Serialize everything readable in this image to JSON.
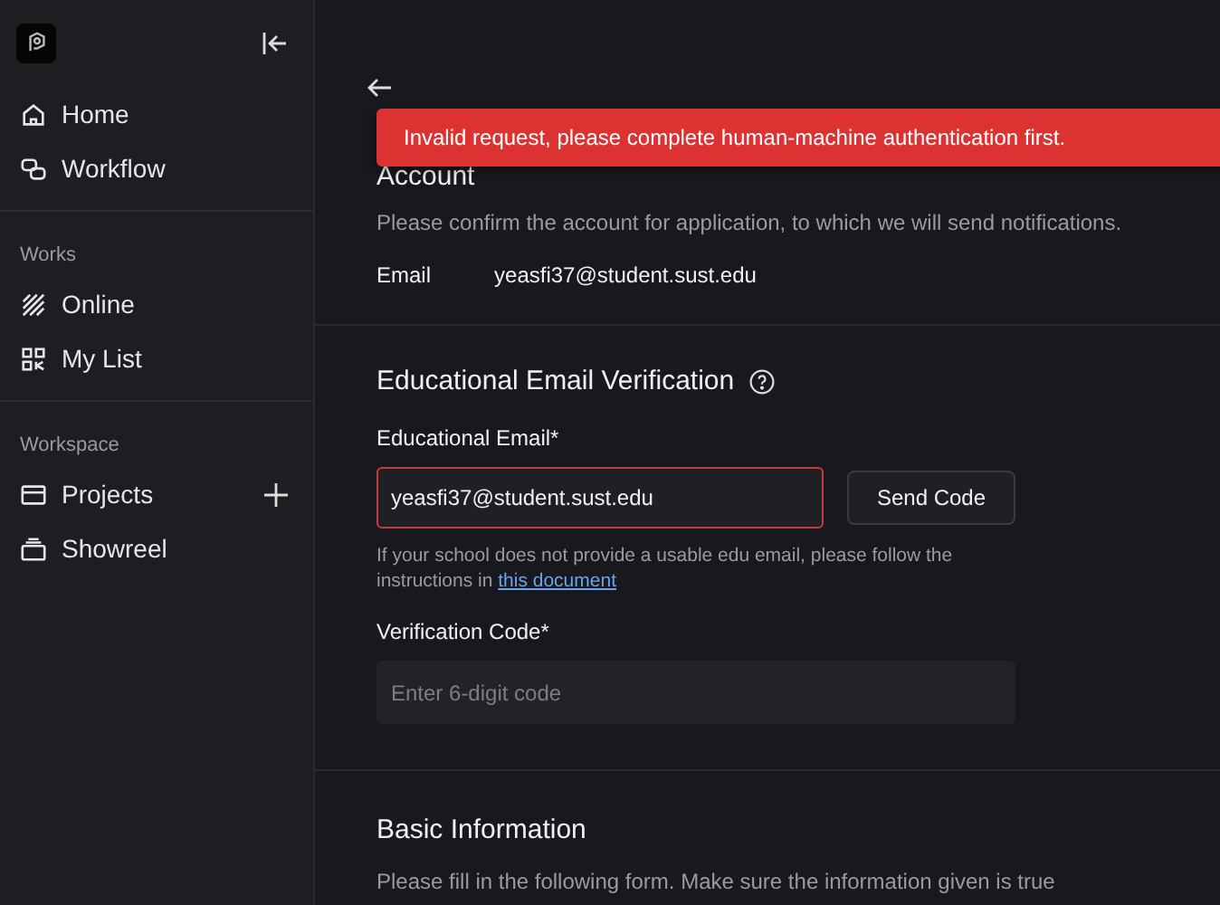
{
  "sidebar": {
    "nav": [
      {
        "label": "Home",
        "selected": false
      },
      {
        "label": "Workflow",
        "selected": false
      }
    ],
    "sections": [
      {
        "title": "Works",
        "items": [
          {
            "label": "Online",
            "selected": false
          },
          {
            "label": "My List",
            "selected": false
          }
        ]
      },
      {
        "title": "Workspace",
        "items": [
          {
            "label": "Projects",
            "selected": false,
            "addable": true
          },
          {
            "label": "Showreel",
            "selected": false,
            "addable": false
          }
        ]
      }
    ]
  },
  "toast": {
    "message": "Invalid request, please complete human-machine authentication first."
  },
  "account": {
    "title": "Account",
    "description": "Please confirm the account for application, to which we will send notifications.",
    "email_label": "Email",
    "email_value": "yeasfi37@student.sust.edu"
  },
  "verification": {
    "title": "Educational Email Verification",
    "email_label": "Educational Email*",
    "email_value": "yeasfi37@student.sust.edu",
    "email_error": true,
    "send_button": "Send Code",
    "help_text": "If your school does not provide a usable edu email, please follow the instructions in ",
    "help_link": "this document",
    "code_label": "Verification Code*",
    "code_placeholder": "Enter 6-digit code"
  },
  "basic": {
    "title": "Basic Information",
    "description": "Please fill in the following form. Make sure the information given is true"
  }
}
